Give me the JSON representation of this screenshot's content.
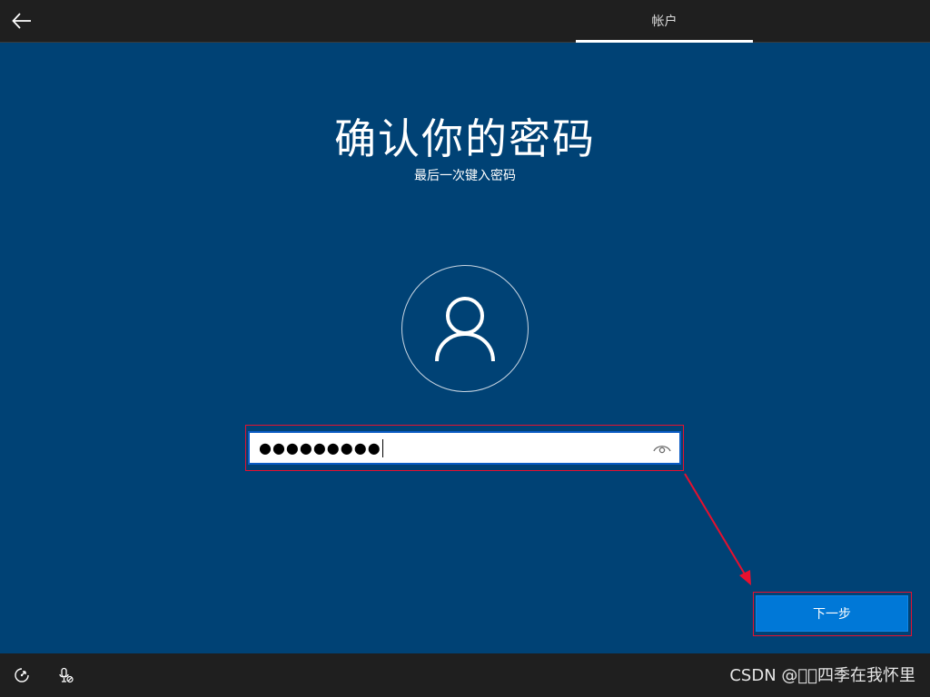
{
  "header": {
    "back_icon": "arrow-left-icon",
    "tab_label": "帐户"
  },
  "main": {
    "title": "确认你的密码",
    "subtitle": "最后一次键入密码",
    "avatar_icon": "user-icon",
    "password": {
      "value": "●●●●●●●●●",
      "reveal_icon": "eye-icon"
    },
    "next_button_label": "下一步"
  },
  "footer": {
    "ease_of_access_icon": "ease-of-access-icon",
    "microphone_icon": "microphone-muted-icon",
    "watermark": "CSDN @\u0000\u0000四季在我怀里"
  },
  "colors": {
    "background": "#004275",
    "bar": "#1f1f1f",
    "accent": "#0078d7",
    "highlight": "#e8102e"
  }
}
